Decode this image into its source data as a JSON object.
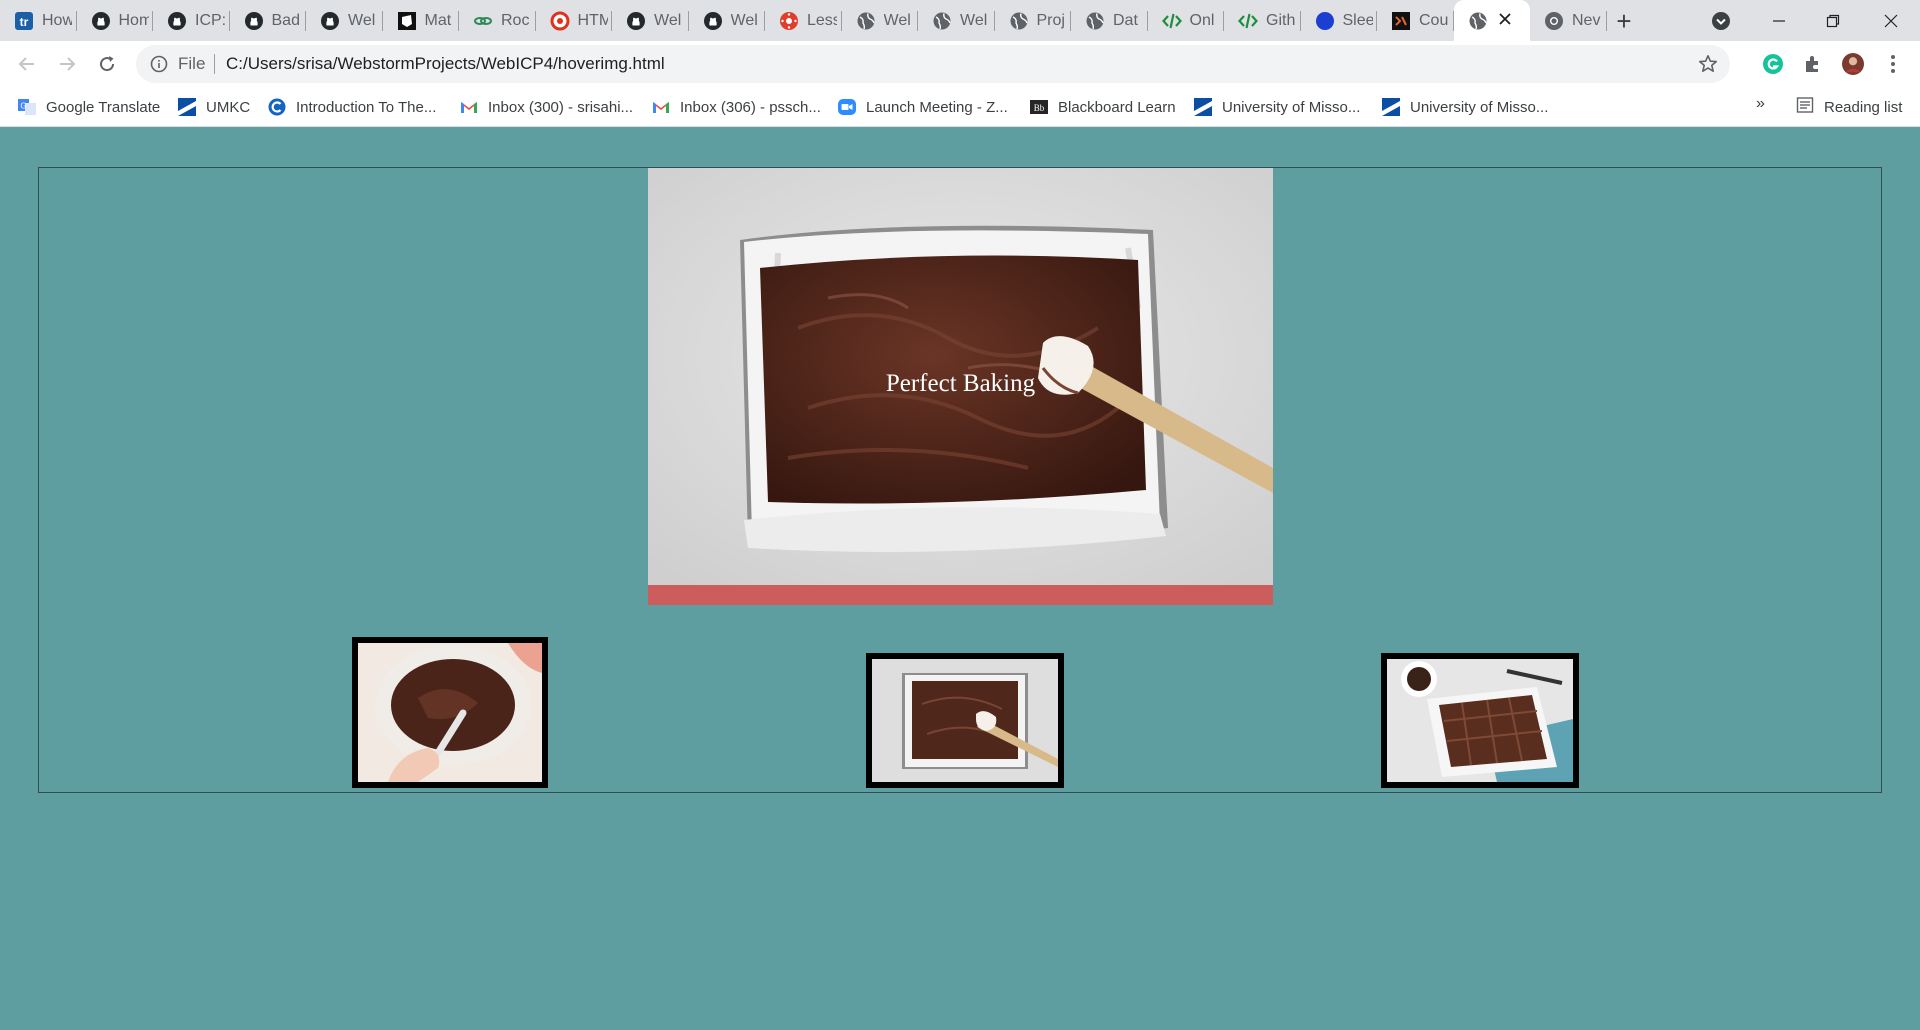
{
  "browser": {
    "tabs": [
      {
        "label": "How",
        "icon": "trello-icon"
      },
      {
        "label": "Hom",
        "icon": "github-icon"
      },
      {
        "label": "ICP:",
        "icon": "github-icon"
      },
      {
        "label": "Bad",
        "icon": "github-icon"
      },
      {
        "label": "Wel",
        "icon": "github-icon"
      },
      {
        "label": "Mat",
        "icon": "codepen-icon"
      },
      {
        "label": "Roc",
        "icon": "rocket-icon"
      },
      {
        "label": "HTM",
        "icon": "html-icon"
      },
      {
        "label": "Wel",
        "icon": "github-icon"
      },
      {
        "label": "Wel",
        "icon": "github-icon"
      },
      {
        "label": "Less",
        "icon": "canvas-icon"
      },
      {
        "label": "Wel",
        "icon": "globe-icon"
      },
      {
        "label": "Wel",
        "icon": "globe-icon"
      },
      {
        "label": "Proj",
        "icon": "globe-icon"
      },
      {
        "label": "Dat",
        "icon": "globe-icon"
      },
      {
        "label": "Onl",
        "icon": "code-icon"
      },
      {
        "label": "Gith",
        "icon": "code-icon"
      },
      {
        "label": "Slee",
        "icon": "blue-dot-icon"
      },
      {
        "label": "Cou",
        "icon": "coursera-icon"
      },
      {
        "label": "",
        "icon": "globe-icon",
        "active": true
      },
      {
        "label": "Nev",
        "icon": "chrome-icon"
      }
    ],
    "new_tab": "+",
    "address": {
      "scheme_label": "File",
      "url": "C:/Users/srisa/WebstormProjects/WebICP4/hoverimg.html"
    },
    "bookmarks": [
      {
        "label": "Google Translate",
        "icon": "translate-icon"
      },
      {
        "label": "UMKC",
        "icon": "umkc-icon"
      },
      {
        "label": "Introduction To The...",
        "icon": "c-icon"
      },
      {
        "label": "Inbox (300) - srisahi...",
        "icon": "gmail-icon"
      },
      {
        "label": "Inbox (306) - pssch...",
        "icon": "gmail-icon"
      },
      {
        "label": "Launch Meeting - Z...",
        "icon": "zoom-icon"
      },
      {
        "label": "Blackboard Learn",
        "icon": "blackboard-icon"
      },
      {
        "label": "University of Misso...",
        "icon": "umkc-icon"
      },
      {
        "label": "University of Misso...",
        "icon": "umkc-icon"
      }
    ],
    "bookmarks_more": "»",
    "reading_list": "Reading list"
  },
  "page": {
    "hero_caption": "Perfect Baking",
    "colors": {
      "background": "#5f9ea0",
      "hero_bar": "#cd5c5c"
    },
    "thumbnails": [
      {
        "name": "mixing-bowl-image"
      },
      {
        "name": "brownie-batter-pan-image"
      },
      {
        "name": "baked-brownies-image"
      }
    ]
  }
}
